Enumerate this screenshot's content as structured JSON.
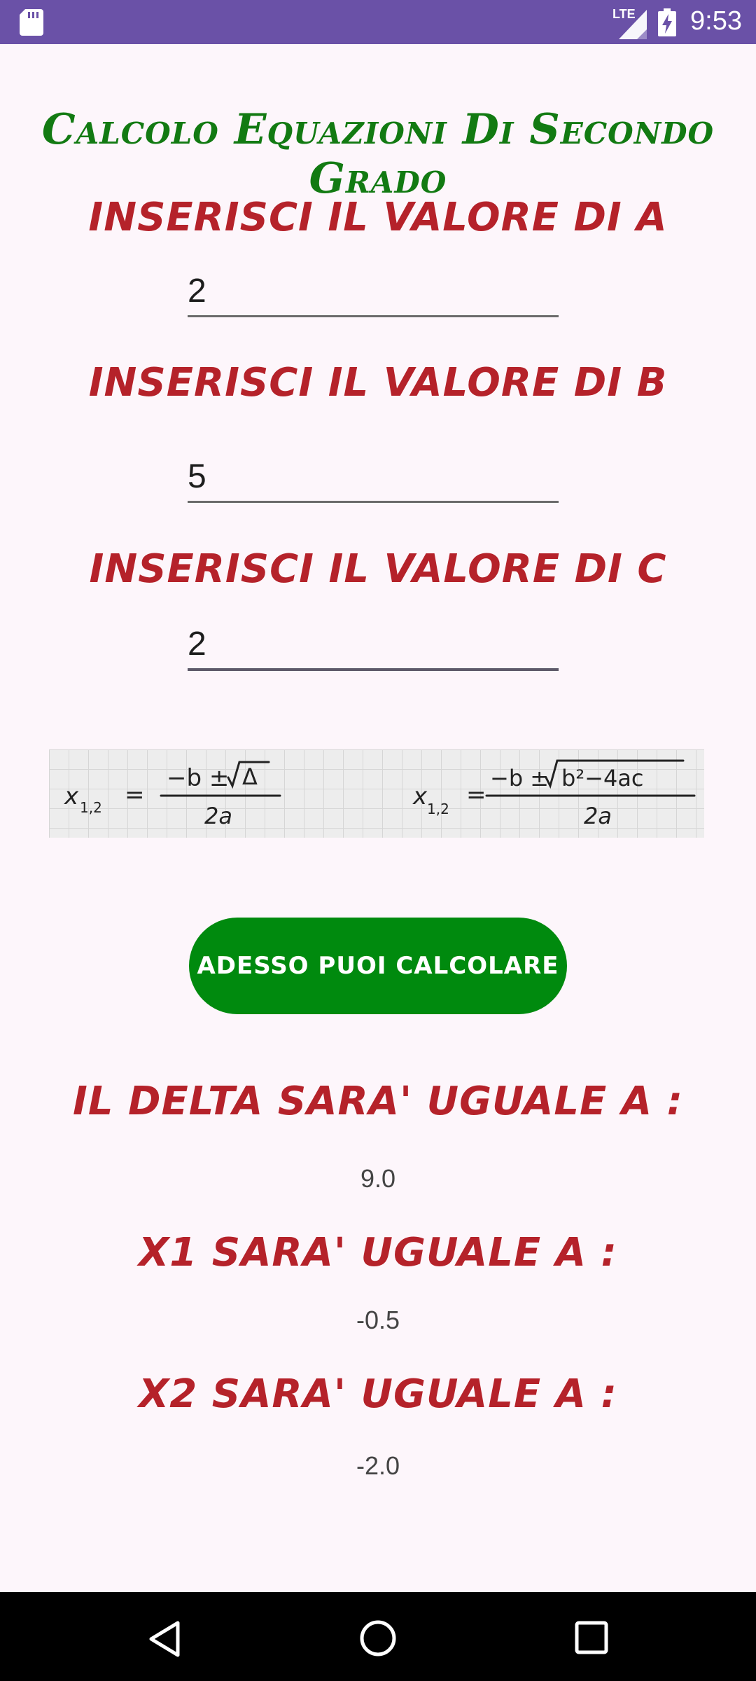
{
  "status_bar": {
    "clock": "9:53",
    "network": "LTE",
    "icons": [
      "sd-card-icon",
      "signal-icon",
      "battery-charging-icon"
    ]
  },
  "title": "Calcolo Equazioni Di Secondo Grado",
  "inputs": [
    {
      "label": "INSERISCI IL VALORE DI A",
      "value": "2"
    },
    {
      "label": "INSERISCI IL VALORE DI B",
      "value": "5"
    },
    {
      "label": "INSERISCI IL VALORE DI C",
      "value": "2"
    }
  ],
  "formula_image": {
    "left": "x₁,₂ = (−b ± √Δ) / 2a",
    "right": "x₁,₂ = (−b ± √(b²−4ac)) / 2a"
  },
  "button": {
    "label": "ADESSO PUOI CALCOLARE"
  },
  "results": [
    {
      "label": "IL DELTA SARA' UGUALE A :",
      "value": "9.0"
    },
    {
      "label": "X1 SARA' UGUALE A :",
      "value": "-0.5"
    },
    {
      "label": "X2 SARA' UGUALE A :",
      "value": "-2.0"
    }
  ],
  "nav": [
    "back-icon",
    "home-icon",
    "recents-icon"
  ],
  "colors": {
    "status_bar": "#6A51A7",
    "title": "#127A12",
    "labels": "#B5222A",
    "button": "#008A0E",
    "background": "#FDF6FB"
  }
}
